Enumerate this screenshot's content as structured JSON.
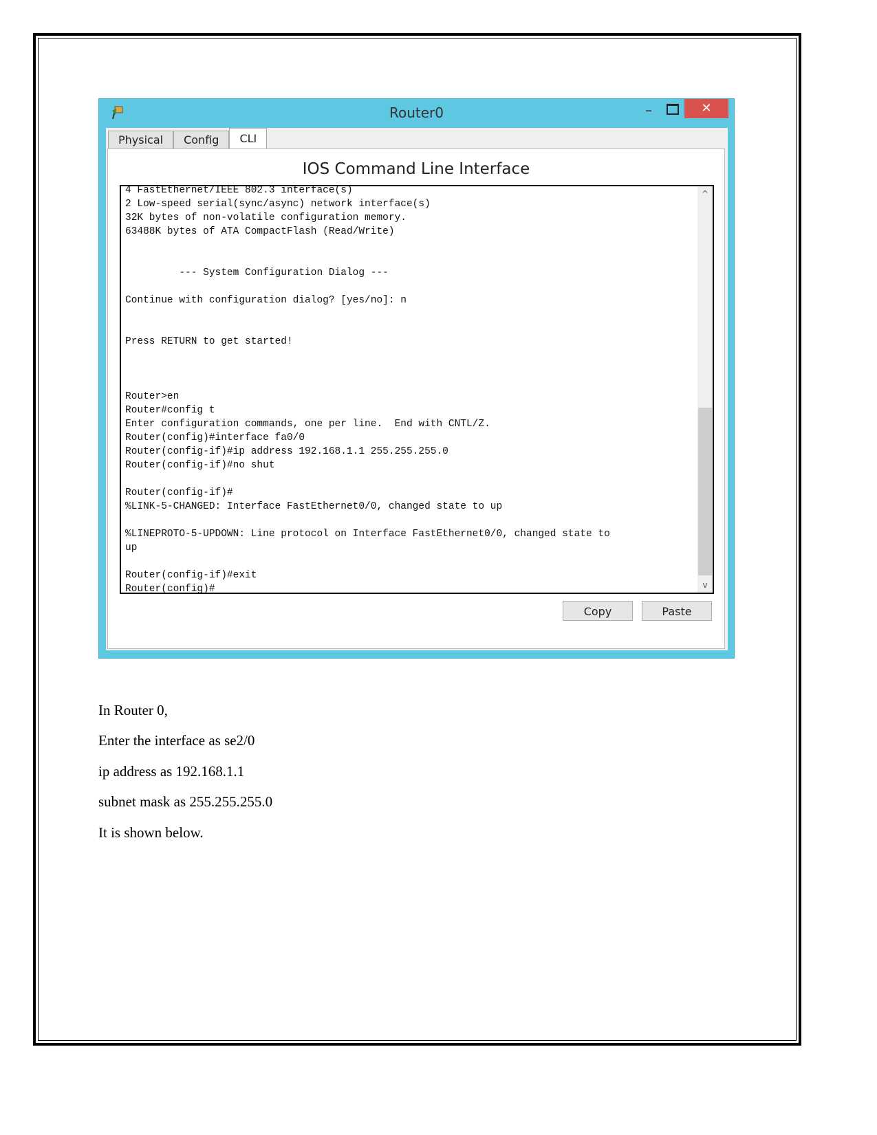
{
  "window": {
    "title": "Router0",
    "minimize_glyph": "–",
    "close_glyph": "✕",
    "tabs": [
      {
        "label": "Physical",
        "active": false
      },
      {
        "label": "Config",
        "active": false
      },
      {
        "label": "CLI",
        "active": true
      }
    ],
    "heading": "IOS Command Line Interface",
    "terminal_lines": [
      "4 FastEthernet/IEEE 802.3 interface(s)",
      "2 Low-speed serial(sync/async) network interface(s)",
      "32K bytes of non-volatile configuration memory.",
      "63488K bytes of ATA CompactFlash (Read/Write)",
      "",
      "",
      "         --- System Configuration Dialog ---",
      "",
      "Continue with configuration dialog? [yes/no]: n",
      "",
      "",
      "Press RETURN to get started!",
      "",
      "",
      "",
      "Router>en",
      "Router#config t",
      "Enter configuration commands, one per line.  End with CNTL/Z.",
      "Router(config)#interface fa0/0",
      "Router(config-if)#ip address 192.168.1.1 255.255.255.0",
      "Router(config-if)#no shut",
      "",
      "Router(config-if)#",
      "%LINK-5-CHANGED: Interface FastEthernet0/0, changed state to up",
      "",
      "%LINEPROTO-5-UPDOWN: Line protocol on Interface FastEthernet0/0, changed state to",
      "up",
      "",
      "Router(config-if)#exit",
      "Router(config)#"
    ],
    "copy_label": "Copy",
    "paste_label": "Paste",
    "colors": {
      "titlebar": "#5ec8e3",
      "close": "#d9524d"
    }
  },
  "paragraphs": [
    "In Router 0,",
    "Enter the interface as se2/0",
    "ip address as 192.168.1.1",
    "subnet mask as 255.255.255.0",
    "It is shown below."
  ]
}
